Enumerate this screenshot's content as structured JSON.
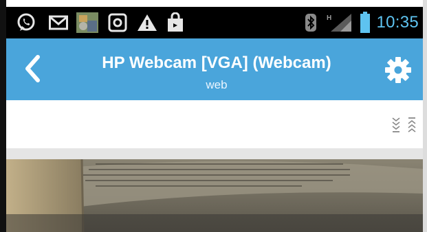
{
  "statusbar": {
    "time": "10:35",
    "icons": [
      "whatsapp-icon",
      "gmail-icon",
      "photo-icon",
      "camera-app-icon",
      "warning-icon",
      "shopping-bag-icon",
      "bluetooth-icon",
      "signal-h-icon",
      "battery-icon"
    ]
  },
  "actionbar": {
    "title": "HP Webcam [VGA] (Webcam)",
    "subtitle": "web"
  },
  "colors": {
    "actionbar": "#4aa5db",
    "statusbar": "#000000",
    "time": "#5ec3f0"
  }
}
